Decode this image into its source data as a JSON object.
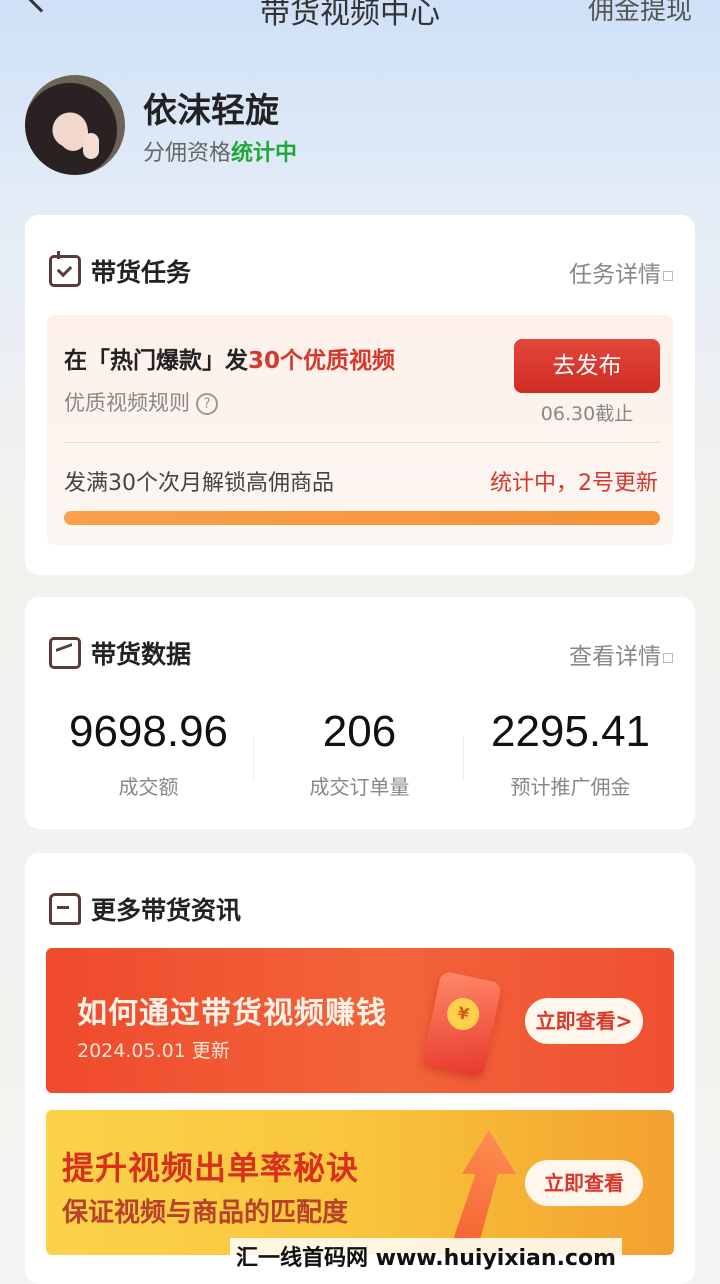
{
  "header": {
    "title": "带货视频中心",
    "right_action": "佣金提现"
  },
  "profile": {
    "name": "依沫轻旋",
    "qualification_label": "分佣资格",
    "qualification_status": "统计中"
  },
  "task_card": {
    "title": "带货任务",
    "detail_link": "任务详情",
    "task_prefix": "在「热门爆款」发",
    "task_highlight": "30个优质视频",
    "rule_text": "优质视频规则",
    "rule_icon": "question-icon",
    "publish_button": "去发布",
    "deadline": "06.30截止",
    "unlock_text": "发满30个次月解锁高佣商品",
    "status_text": "统计中，2号更新",
    "progress_fraction": 1.0
  },
  "data_card": {
    "title": "带货数据",
    "detail_link": "查看详情",
    "stats": [
      {
        "value": "9698.96",
        "label": "成交额"
      },
      {
        "value": "206",
        "label": "成交订单量"
      },
      {
        "value": "2295.41",
        "label": "预计推广佣金"
      }
    ]
  },
  "info_card": {
    "title": "更多带货资讯",
    "banners": [
      {
        "title": "如何通过带货视频赚钱",
        "subtitle": "2024.05.01 更新",
        "button": "立即查看>"
      },
      {
        "title": "提升视频出单率秘诀",
        "subtitle": "保证视频与商品的匹配度",
        "button": "立即查看"
      }
    ]
  },
  "watermark": "汇一线首码网  www.huiyixian.com",
  "colors": {
    "accent_red": "#d7372b",
    "status_green": "#1fa83a",
    "progress_orange": "#f69236"
  }
}
